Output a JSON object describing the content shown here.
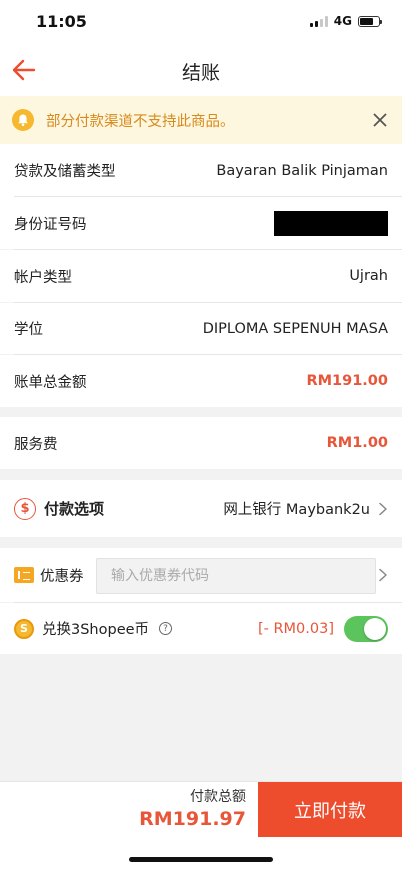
{
  "status_bar": {
    "time": "11:05",
    "network": "4G"
  },
  "header": {
    "title": "结账",
    "back_icon": "arrow-left-icon"
  },
  "notice": {
    "text": "部分付款渠道不支持此商品。",
    "icon": "bell-icon",
    "close_icon": "close-icon"
  },
  "details": [
    {
      "label": "贷款及储蓄类型",
      "value": "Bayaran Balik Pinjaman"
    },
    {
      "label": "身份证号码",
      "value": ""
    },
    {
      "label": "帐户类型",
      "value": "Ujrah"
    },
    {
      "label": "学位",
      "value": "DIPLOMA SEPENUH MASA"
    },
    {
      "label": "账单总金额",
      "value": "RM191.00"
    }
  ],
  "service_fee": {
    "label": "服务费",
    "value": "RM1.00"
  },
  "payment_option": {
    "label": "付款选项",
    "value": "网上银行 Maybank2u",
    "icon": "dollar-circle-icon"
  },
  "voucher": {
    "label": "优惠券",
    "placeholder": "输入优惠券代码",
    "icon": "voucher-icon"
  },
  "coins": {
    "label": "兑换3Shopee币",
    "deduction": "[- RM0.03]",
    "toggle_on": true,
    "icon": "coin-icon"
  },
  "footer": {
    "total_label": "付款总额",
    "total_value": "RM191.97",
    "pay_button": "立即付款"
  },
  "colors": {
    "accent": "#ee4d2d",
    "price": "#e8563a",
    "notice_bg": "#fdf7df",
    "notice_text": "#d88a1c",
    "toggle": "#5cc45d"
  }
}
